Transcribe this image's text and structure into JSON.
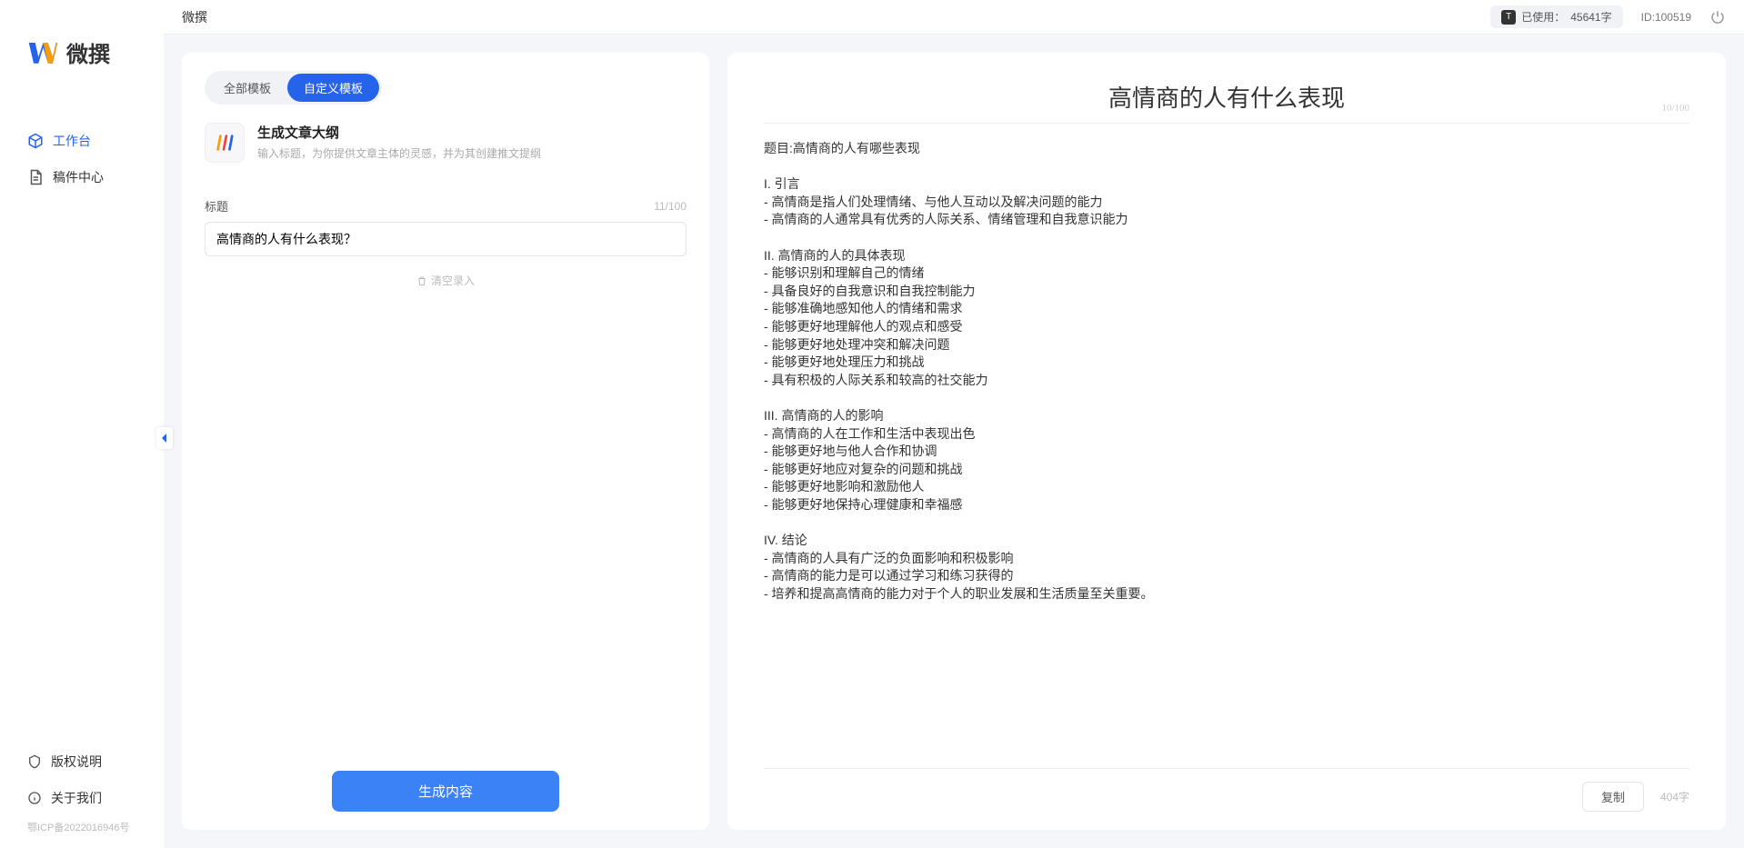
{
  "app": {
    "name": "微撰",
    "icp": "鄂ICP备2022016946号"
  },
  "topbar": {
    "title": "微撰",
    "usage_label": "已使用：",
    "usage_value": "45641字",
    "id_label": "ID:100519"
  },
  "sidebar": {
    "items": [
      {
        "label": "工作台",
        "active": true
      },
      {
        "label": "稿件中心",
        "active": false
      }
    ],
    "footer": [
      {
        "label": "版权说明"
      },
      {
        "label": "关于我们"
      }
    ]
  },
  "left_panel": {
    "tabs": [
      {
        "label": "全部模板",
        "active": false
      },
      {
        "label": "自定义模板",
        "active": true
      }
    ],
    "template": {
      "title": "生成文章大纲",
      "desc": "输入标题，为你提供文章主体的灵感，并为其创建推文提纲"
    },
    "title_field": {
      "label": "标题",
      "value": "高情商的人有什么表现？",
      "count": "11/100"
    },
    "clear_label": "清空录入",
    "generate_label": "生成内容"
  },
  "right_panel": {
    "title": "高情商的人有什么表现",
    "title_count": "10/100",
    "body": "题目:高情商的人有哪些表现\n\nI. 引言\n- 高情商是指人们处理情绪、与他人互动以及解决问题的能力\n- 高情商的人通常具有优秀的人际关系、情绪管理和自我意识能力\n\nII. 高情商的人的具体表现\n- 能够识别和理解自己的情绪\n- 具备良好的自我意识和自我控制能力\n- 能够准确地感知他人的情绪和需求\n- 能够更好地理解他人的观点和感受\n- 能够更好地处理冲突和解决问题\n- 能够更好地处理压力和挑战\n- 具有积极的人际关系和较高的社交能力\n\nIII. 高情商的人的影响\n- 高情商的人在工作和生活中表现出色\n- 能够更好地与他人合作和协调\n- 能够更好地应对复杂的问题和挑战\n- 能够更好地影响和激励他人\n- 能够更好地保持心理健康和幸福感\n\nIV. 结论\n- 高情商的人具有广泛的负面影响和积极影响\n- 高情商的能力是可以通过学习和练习获得的\n- 培养和提高高情商的能力对于个人的职业发展和生活质量至关重要。",
    "copy_label": "复制",
    "word_count": "404字"
  }
}
